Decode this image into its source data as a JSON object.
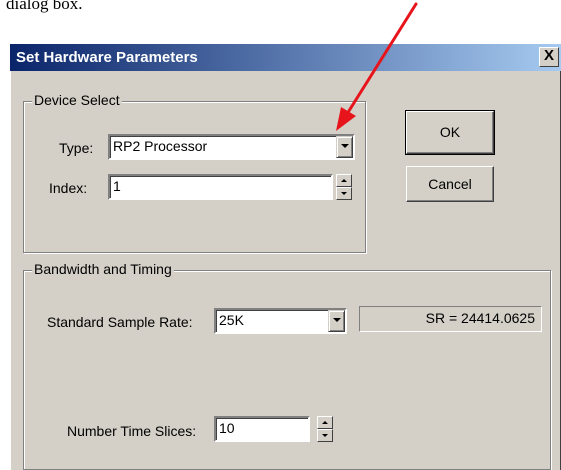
{
  "document": {
    "fragment_text": "dialog box."
  },
  "dialog": {
    "title": "Set Hardware Parameters",
    "close_glyph": "X",
    "buttons": {
      "ok_label": "OK",
      "cancel_label": "Cancel"
    },
    "device_select": {
      "legend": "Device Select",
      "type_label": "Type:",
      "type_value": "RP2  Processor",
      "index_label": "Index:",
      "index_value": "1"
    },
    "bandwidth_timing": {
      "legend": "Bandwidth and Timing",
      "sample_rate_label": "Standard Sample Rate:",
      "sample_rate_value": "25K",
      "sr_readout": "SR =  24414.0625",
      "time_slices_label": "Number Time Slices:",
      "time_slices_value": "10"
    }
  },
  "annotation": {
    "arrow_color": "#e8141c"
  },
  "colors": {
    "titlebar_start": "#0a246a",
    "titlebar_end": "#a6caf0",
    "dialog_face": "#d4d0c8"
  }
}
